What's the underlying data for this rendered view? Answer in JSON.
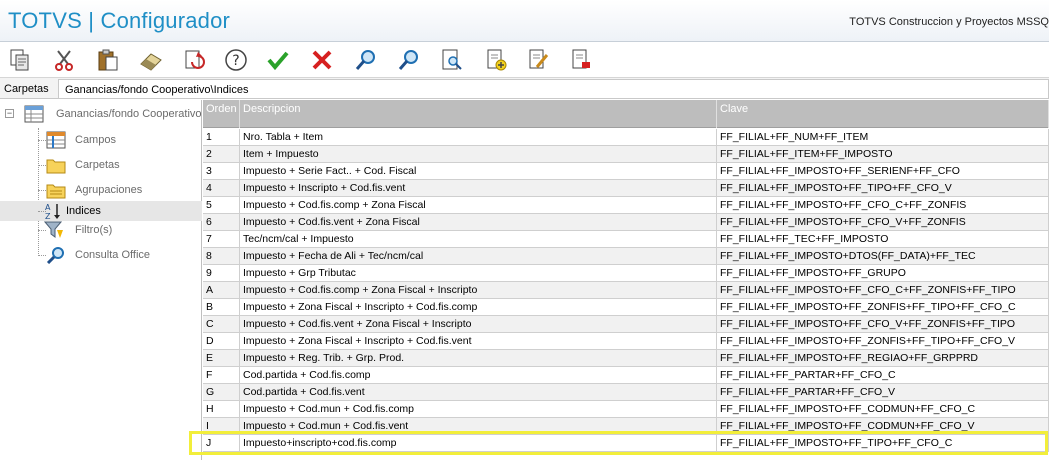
{
  "window": {
    "app_title": "TOTVS | Configurador",
    "company": "TOTVS Construccion y Proyectos MSSQ"
  },
  "toolbar": {
    "buttons": [
      {
        "name": "copy-icon"
      },
      {
        "name": "cut-icon"
      },
      {
        "name": "paste-icon"
      },
      {
        "name": "eraser-icon"
      },
      {
        "name": "refresh-icon"
      },
      {
        "name": "help-icon"
      },
      {
        "name": "confirm-icon",
        "color": "#2aa22a"
      },
      {
        "name": "cancel-icon",
        "color": "#d62020"
      },
      {
        "name": "search-icon"
      },
      {
        "name": "search-next-icon"
      },
      {
        "name": "preview-icon"
      },
      {
        "name": "add-document-icon"
      },
      {
        "name": "edit-document-icon"
      },
      {
        "name": "delete-document-icon"
      }
    ]
  },
  "pathbar": {
    "label": "Carpetas",
    "value": "Ganancias/fondo Cooperativo\\Indices"
  },
  "tree": {
    "root": "Ganancias/fondo Cooperativo",
    "items": [
      {
        "label": "Campos",
        "icon": "fields-icon"
      },
      {
        "label": "Carpetas",
        "icon": "folder-icon"
      },
      {
        "label": "Agrupaciones",
        "icon": "grouping-icon"
      },
      {
        "label": "Indices",
        "icon": "sort-az-icon"
      },
      {
        "label": "Filtro(s)",
        "icon": "filter-icon"
      },
      {
        "label": "Consulta Office",
        "icon": "search-icon"
      }
    ]
  },
  "grid": {
    "headers": [
      "Orden",
      "Descripcion",
      "Clave"
    ],
    "rows": [
      [
        "1",
        "Nro. Tabla + Item",
        "FF_FILIAL+FF_NUM+FF_ITEM"
      ],
      [
        "2",
        "Item + Impuesto",
        "FF_FILIAL+FF_ITEM+FF_IMPOSTO"
      ],
      [
        "3",
        "Impuesto + Serie Fact.. + Cod. Fiscal",
        "FF_FILIAL+FF_IMPOSTO+FF_SERIENF+FF_CFO"
      ],
      [
        "4",
        "Impuesto + Inscripto + Cod.fis.vent",
        "FF_FILIAL+FF_IMPOSTO+FF_TIPO+FF_CFO_V"
      ],
      [
        "5",
        "Impuesto + Cod.fis.comp + Zona Fiscal",
        "FF_FILIAL+FF_IMPOSTO+FF_CFO_C+FF_ZONFIS"
      ],
      [
        "6",
        "Impuesto + Cod.fis.vent + Zona Fiscal",
        "FF_FILIAL+FF_IMPOSTO+FF_CFO_V+FF_ZONFIS"
      ],
      [
        "7",
        "Tec/ncm/cal + Impuesto",
        "FF_FILIAL+FF_TEC+FF_IMPOSTO"
      ],
      [
        "8",
        "Impuesto + Fecha de Ali + Tec/ncm/cal",
        "FF_FILIAL+FF_IMPOSTO+DTOS(FF_DATA)+FF_TEC"
      ],
      [
        "9",
        "Impuesto + Grp Tributac",
        "FF_FILIAL+FF_IMPOSTO+FF_GRUPO"
      ],
      [
        "A",
        "Impuesto + Cod.fis.comp + Zona Fiscal + Inscripto",
        "FF_FILIAL+FF_IMPOSTO+FF_CFO_C+FF_ZONFIS+FF_TIPO"
      ],
      [
        "B",
        "Impuesto + Zona Fiscal + Inscripto + Cod.fis.comp",
        "FF_FILIAL+FF_IMPOSTO+FF_ZONFIS+FF_TIPO+FF_CFO_C"
      ],
      [
        "C",
        "Impuesto + Cod.fis.vent + Zona Fiscal + Inscripto",
        "FF_FILIAL+FF_IMPOSTO+FF_CFO_V+FF_ZONFIS+FF_TIPO"
      ],
      [
        "D",
        "Impuesto + Zona Fiscal + Inscripto + Cod.fis.vent",
        "FF_FILIAL+FF_IMPOSTO+FF_ZONFIS+FF_TIPO+FF_CFO_V"
      ],
      [
        "E",
        "Impuesto + Reg. Trib. + Grp. Prod.",
        "FF_FILIAL+FF_IMPOSTO+FF_REGIAO+FF_GRPPRD"
      ],
      [
        "F",
        "Cod.partida + Cod.fis.comp",
        "FF_FILIAL+FF_PARTAR+FF_CFO_C"
      ],
      [
        "G",
        "Cod.partida + Cod.fis.vent",
        "FF_FILIAL+FF_PARTAR+FF_CFO_V"
      ],
      [
        "H",
        "Impuesto + Cod.mun + Cod.fis.comp",
        "FF_FILIAL+FF_IMPOSTO+FF_CODMUN+FF_CFO_C"
      ],
      [
        "I",
        "Impuesto + Cod.mun + Cod.fis.vent",
        "FF_FILIAL+FF_IMPOSTO+FF_CODMUN+FF_CFO_V"
      ],
      [
        "J",
        "Impuesto+inscripto+cod.fis.comp",
        "FF_FILIAL+FF_IMPOSTO+FF_TIPO+FF_CFO_C"
      ]
    ],
    "highlight_color": "#f2ee3a"
  }
}
